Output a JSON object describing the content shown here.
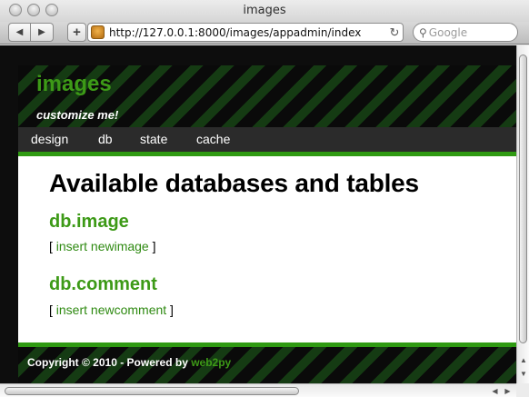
{
  "window": {
    "title": "images"
  },
  "toolbar": {
    "back_icon": "back-arrow-icon",
    "forward_icon": "forward-arrow-icon",
    "add_icon": "plus-icon",
    "url": "http://127.0.0.1:8000/images/appadmin/index",
    "search_placeholder": "Google"
  },
  "header": {
    "app_name": "images",
    "tagline": "customize me!"
  },
  "menu": {
    "design": "design",
    "db": "db",
    "state": "state",
    "cache": "cache"
  },
  "content": {
    "title": "Available databases and tables",
    "databases": [
      {
        "name": "db.image",
        "open": "[ ",
        "link": "insert newimage",
        "close": " ]"
      },
      {
        "name": "db.comment",
        "open": "[ ",
        "link": "insert newcomment",
        "close": " ]"
      }
    ]
  },
  "footer": {
    "text": "Copyright © 2010 - Powered by ",
    "link": "web2py"
  },
  "colors": {
    "accent_green": "#3d9a17",
    "bar_green": "#2f9a12",
    "menu_bg": "#2b2b2b"
  }
}
